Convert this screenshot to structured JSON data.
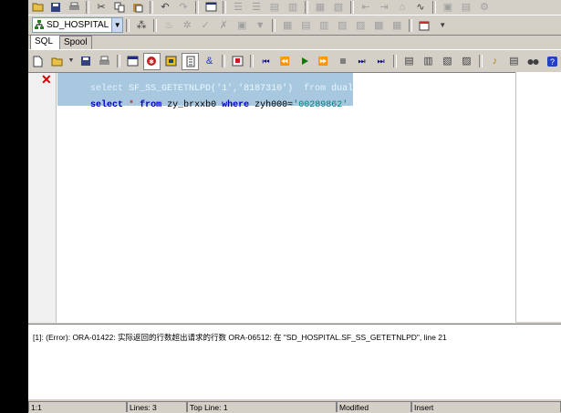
{
  "connection": {
    "label": "SD_HOSPITAL"
  },
  "tabs": [
    {
      "label": "SQL"
    },
    {
      "label": "Spool"
    }
  ],
  "editor": {
    "line1": {
      "kw1": "select",
      "ident": "SF_SS_GETETNLPD(",
      "str": "'1','8187310'",
      "close": ")",
      "kw2": "from",
      "ident2": "dual"
    },
    "line2": {
      "kw1": "select",
      "star": "*",
      "kw2": "from",
      "ident": "zy_brxxb0",
      "kw3": "where",
      "cond": "zyh000=",
      "str": "'00289862'"
    }
  },
  "output": {
    "message": "[1]: (Error): ORA-01422: 实际返回的行数超出请求的行数 ORA-06512: 在 \"SD_HOSPITAL.SF_SS_GETETNLPD\", line 21"
  },
  "status": {
    "position": "1:1",
    "lines": "Lines: 3",
    "top_line": "Top Line: 1",
    "modified": "Modified",
    "mode": "Insert"
  },
  "icons": [
    "open-icon",
    "save-icon",
    "print-icon",
    "cut-icon",
    "copy-icon",
    "paste-icon",
    "undo-icon",
    "redo-icon",
    "execute-icon",
    "stop-icon",
    "step-icon",
    "commit-icon",
    "rollback-icon",
    "find-icon"
  ]
}
